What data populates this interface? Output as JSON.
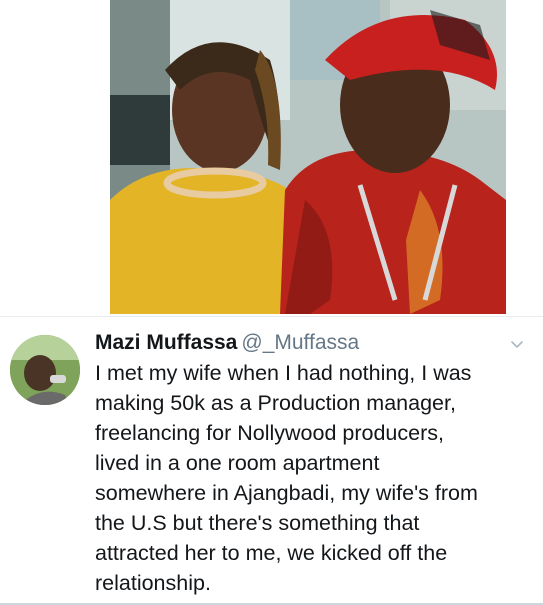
{
  "tweet": {
    "display_name": "Mazi Muffassa",
    "handle": "@_Muffassa",
    "text_lines": [
      "I met my wife when I had nothing, I was",
      "making 50k as a Production manager,",
      "freelancing for Nollywood producers,",
      "lived in a one room apartment",
      "somewhere in Ajangbadi, my wife's from",
      "the U.S but there's something that",
      "attracted her to me, we kicked off the",
      "relationship."
    ]
  },
  "icons": {
    "menu": "chevron-down-icon"
  },
  "colors": {
    "name": "#14171a",
    "handle": "#657786",
    "divider": "#e6ecf0"
  }
}
